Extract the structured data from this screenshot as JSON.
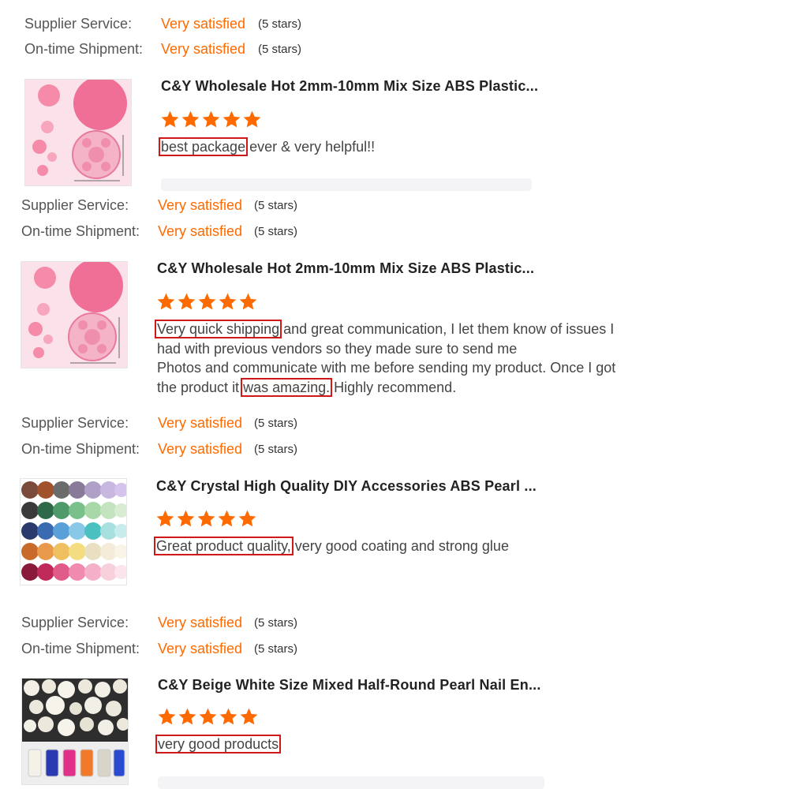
{
  "colors": {
    "accent": "#ff6a00",
    "highlight_box": "#d01818"
  },
  "ratings_label_supplier": "Supplier Service:",
  "ratings_label_shipment": "On-time Shipment:",
  "reviews": [
    {
      "supplier_service": {
        "value": "Very satisfied",
        "note": "(5 stars)"
      },
      "ontime_shipment": {
        "value": "Very satisfied",
        "note": "(5 stars)"
      }
    },
    {
      "product_title": "C&Y Wholesale Hot 2mm-10mm Mix Size ABS Plastic...",
      "star_rating": 5,
      "review_parts": [
        {
          "text": "best package",
          "highlight": true
        },
        {
          "text": " ever & very helpful!!",
          "highlight": false
        }
      ],
      "supplier_service": {
        "value": "Very satisfied",
        "note": "(5 stars)"
      },
      "ontime_shipment": {
        "value": "Very satisfied",
        "note": "(5 stars)"
      }
    },
    {
      "product_title": "C&Y Wholesale Hot 2mm-10mm Mix Size ABS Plastic...",
      "star_rating": 5,
      "review_lines": [
        [
          {
            "text": "Very quick shipping",
            "highlight": true
          },
          {
            "text": " and great communication, I let them know of issues I",
            "highlight": false
          }
        ],
        [
          {
            "text": "had with previous vendors so they made sure to send me",
            "highlight": false
          }
        ],
        [
          {
            "text": "Photos and communicate with me before sending my product. Once I got",
            "highlight": false
          }
        ],
        [
          {
            "text": "the product it ",
            "highlight": false
          },
          {
            "text": "was amazing.",
            "highlight": true
          },
          {
            "text": " Highly recommend.",
            "highlight": false
          }
        ]
      ],
      "supplier_service": {
        "value": "Very satisfied",
        "note": "(5 stars)"
      },
      "ontime_shipment": {
        "value": "Very satisfied",
        "note": "(5 stars)"
      }
    },
    {
      "product_title": "C&Y Crystal High Quality DIY Accessories ABS Pearl ...",
      "star_rating": 5,
      "review_parts": [
        {
          "text": "Great product quality,",
          "highlight": true
        },
        {
          "text": " very good coating and strong glue",
          "highlight": false
        }
      ],
      "supplier_service": {
        "value": "Very satisfied",
        "note": "(5 stars)"
      },
      "ontime_shipment": {
        "value": "Very satisfied",
        "note": "(5 stars)"
      }
    },
    {
      "product_title": "C&Y Beige White Size Mixed Half-Round Pearl Nail En...",
      "star_rating": 5,
      "review_parts": [
        {
          "text": "very good products",
          "highlight": true
        }
      ]
    }
  ]
}
